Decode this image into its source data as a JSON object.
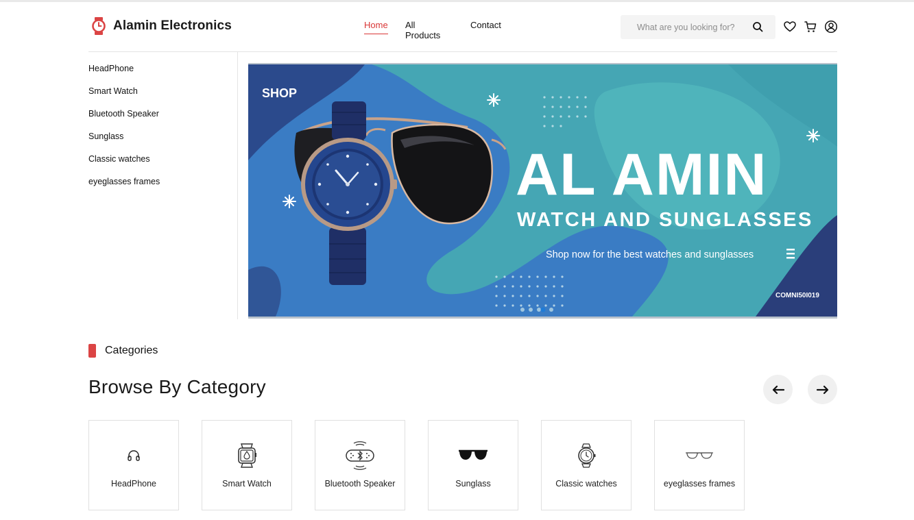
{
  "header": {
    "brand_name": "Alamin Electronics",
    "nav": {
      "home": "Home",
      "products": "All Products",
      "contact": "Contact"
    },
    "search_placeholder": "What are you looking for?",
    "icons": [
      "search-icon",
      "heart-icon",
      "cart-icon",
      "user-icon"
    ]
  },
  "sidebar": {
    "items": [
      "HeadPhone",
      "Smart Watch",
      "Bluetooth Speaker",
      "Sunglass",
      "Classic watches",
      "eyeglasses frames"
    ]
  },
  "banner": {
    "shop": "SHOP",
    "headline": "AL AMIN",
    "subheadline": "WATCH AND SUNGLASSES",
    "tagline": "Shop now for the best watches and sunglasses",
    "code": "COMNI50I019",
    "slides": 5,
    "active_slide": 3
  },
  "categories": {
    "section_label": "Categories",
    "title": "Browse By Category",
    "items": [
      {
        "label": "HeadPhone",
        "icon": "headphone-icon"
      },
      {
        "label": "Smart Watch",
        "icon": "smartwatch-icon"
      },
      {
        "label": "Bluetooth Speaker",
        "icon": "bluetooth-speaker-icon"
      },
      {
        "label": "Sunglass",
        "icon": "sunglass-icon"
      },
      {
        "label": "Classic watches",
        "icon": "classic-watch-icon"
      },
      {
        "label": "eyeglasses frames",
        "icon": "eyeglasses-icon"
      }
    ]
  },
  "colors": {
    "accent": "#db4444",
    "banner_blue": "#3b7bc4",
    "banner_teal": "#4fb3b5",
    "banner_navy": "#2a3e7a"
  }
}
